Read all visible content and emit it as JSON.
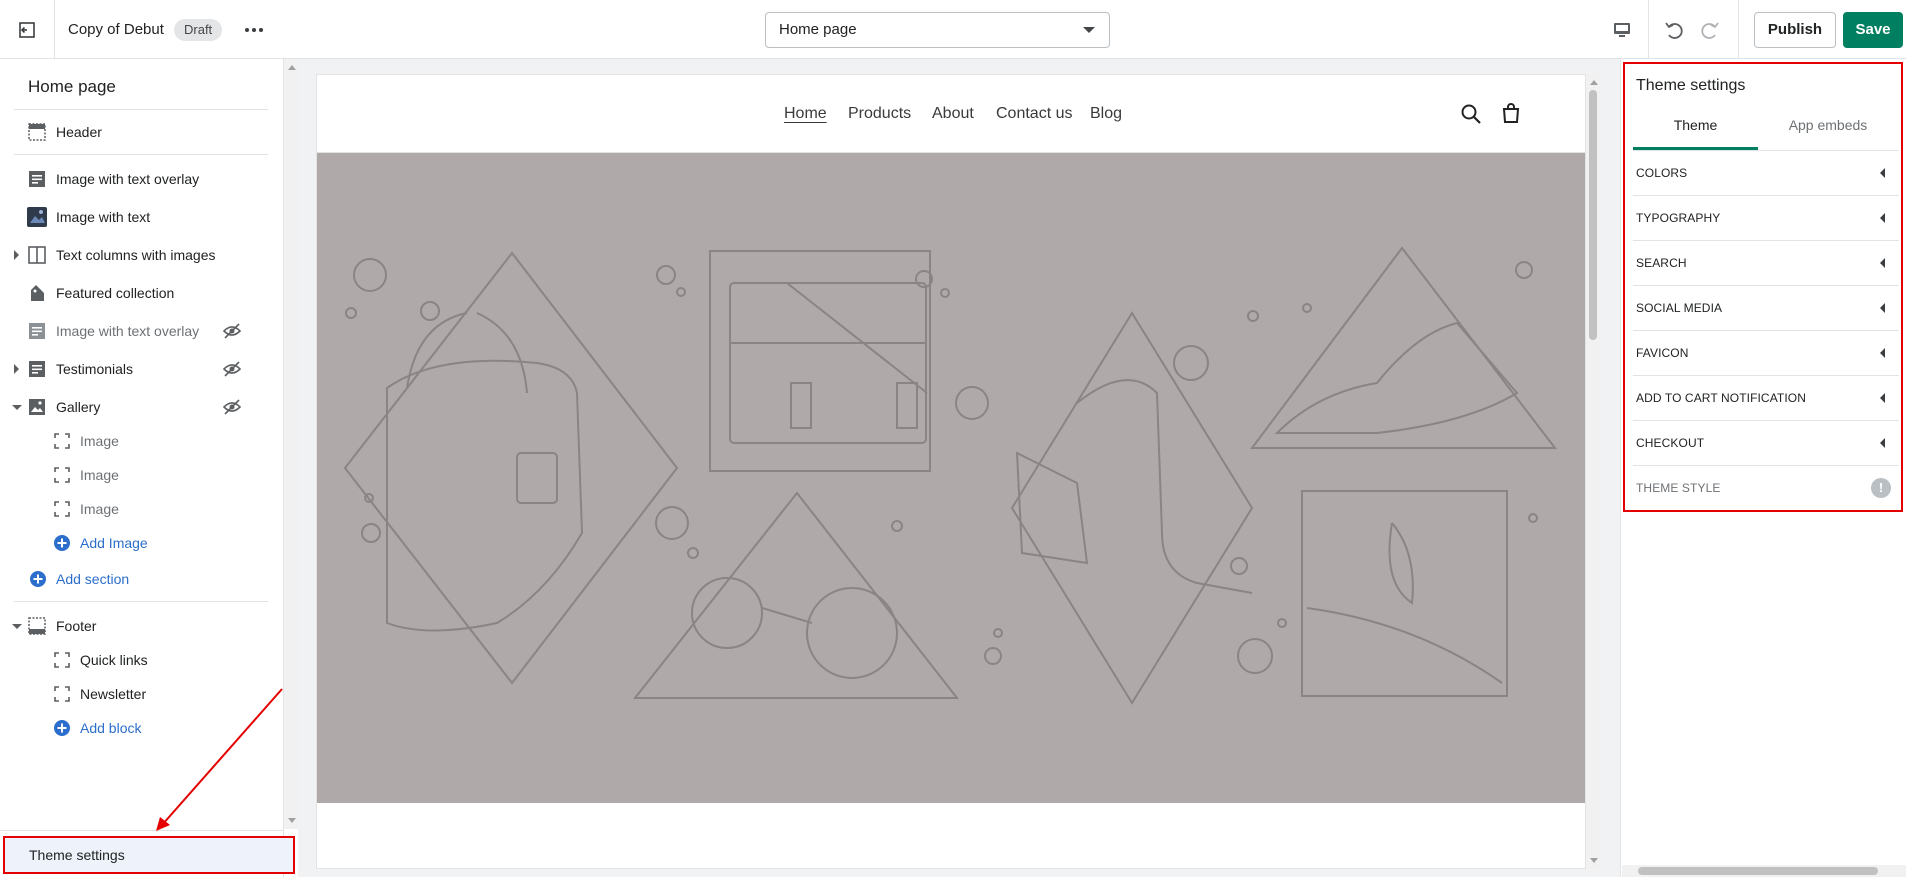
{
  "topbar": {
    "theme_name": "Copy of Debut",
    "status_badge": "Draft",
    "page_select_value": "Home page",
    "publish_label": "Publish",
    "save_label": "Save"
  },
  "sidebar": {
    "title": "Home page",
    "sections": [
      {
        "label": "Header"
      },
      {
        "label": "Image with text overlay"
      },
      {
        "label": "Image with text"
      },
      {
        "label": "Text columns with images"
      },
      {
        "label": "Featured collection"
      },
      {
        "label": "Image with text overlay"
      },
      {
        "label": "Testimonials"
      },
      {
        "label": "Gallery"
      }
    ],
    "gallery_blocks": [
      {
        "label": "Image"
      },
      {
        "label": "Image"
      },
      {
        "label": "Image"
      }
    ],
    "add_image_label": "Add Image",
    "add_section_label": "Add section",
    "footer_label": "Footer",
    "footer_blocks": [
      {
        "label": "Quick links"
      },
      {
        "label": "Newsletter"
      }
    ],
    "add_block_label": "Add block",
    "theme_settings_label": "Theme settings"
  },
  "preview": {
    "nav": [
      {
        "label": "Home"
      },
      {
        "label": "Products"
      },
      {
        "label": "About"
      },
      {
        "label": "Contact us"
      },
      {
        "label": "Blog"
      }
    ],
    "hero_color": "#b0a9a9"
  },
  "theme_settings": {
    "title": "Theme settings",
    "tabs": [
      {
        "label": "Theme"
      },
      {
        "label": "App embeds"
      }
    ],
    "rows": [
      {
        "label": "COLORS"
      },
      {
        "label": "TYPOGRAPHY"
      },
      {
        "label": "SEARCH"
      },
      {
        "label": "SOCIAL MEDIA"
      },
      {
        "label": "FAVICON"
      },
      {
        "label": "ADD TO CART NOTIFICATION"
      },
      {
        "label": "CHECKOUT"
      },
      {
        "label": "THEME STYLE"
      }
    ],
    "info_icon": "!"
  },
  "colors": {
    "accent": "#008060",
    "link": "#2c6ecb",
    "highlight": "#e40000"
  }
}
